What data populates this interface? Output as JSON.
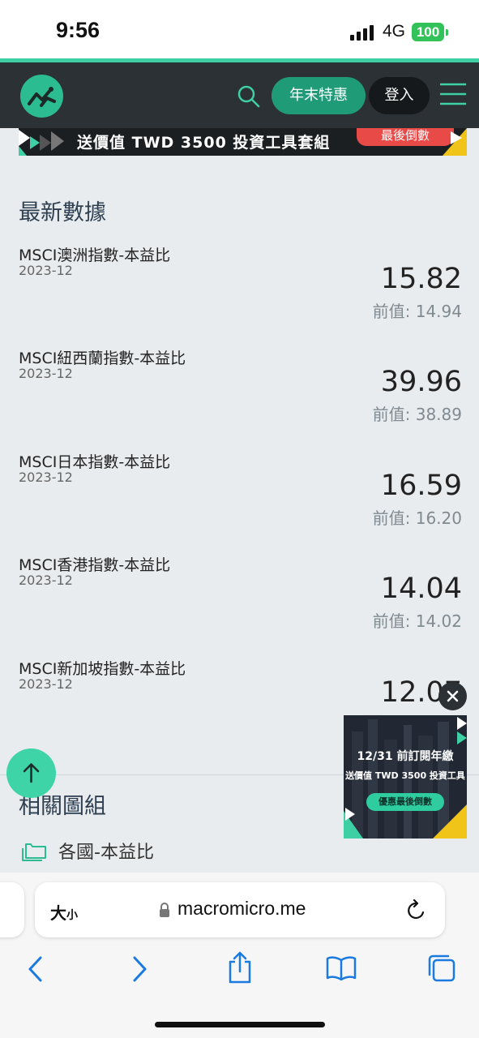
{
  "status": {
    "time": "9:56",
    "network": "4G",
    "battery": "100"
  },
  "header": {
    "promo_label": "年末特惠",
    "login_label": "登入"
  },
  "banner": {
    "text": "送價值 TWD 3500 投資工具套組",
    "badge": "最後倒數"
  },
  "latest": {
    "title": "最新數據",
    "items": [
      {
        "name": "MSCI澳洲指數-本益比",
        "date": "2023-12",
        "value": "15.82",
        "prev": "前值: 14.94"
      },
      {
        "name": "MSCI紐西蘭指數-本益比",
        "date": "2023-12",
        "value": "39.96",
        "prev": "前值: 38.89"
      },
      {
        "name": "MSCI日本指數-本益比",
        "date": "2023-12",
        "value": "16.59",
        "prev": "前值: 16.20"
      },
      {
        "name": "MSCI香港指數-本益比",
        "date": "2023-12",
        "value": "14.04",
        "prev": "前值: 14.02"
      },
      {
        "name": "MSCI新加坡指數-本益比",
        "date": "2023-12",
        "value": "12.07",
        "prev": ""
      }
    ]
  },
  "related": {
    "title": "相關圖組",
    "folder_label": "各國-本益比"
  },
  "ad": {
    "line1": "12/31 前訂閱年繳",
    "line2": "送價值 TWD 3500 投資工具",
    "button": "優惠最後倒數"
  },
  "browser": {
    "text_size_label": "大",
    "text_size_small": "小",
    "url": "macromicro.me"
  },
  "colors": {
    "accent": "#3ecfa5",
    "header_bg": "#2c3135",
    "promo": "#1f9b77"
  }
}
